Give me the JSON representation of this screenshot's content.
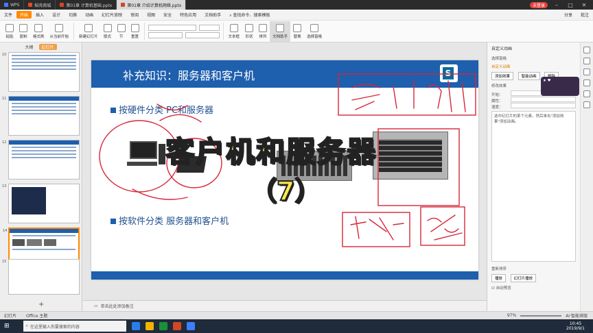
{
  "titlebar": {
    "tabs": [
      {
        "label": "WPS",
        "color": "#3d7eff"
      },
      {
        "label": "稻壳商城",
        "color": "#e34a2b"
      },
      {
        "label": "第01章 计算机基础.pptx",
        "color": "#d24726"
      },
      {
        "label": "第01章 介绍计算机网络.pptx",
        "color": "#d24726"
      }
    ],
    "login_badge": "未登录"
  },
  "menubar": {
    "file_label": "文件",
    "items": [
      "开始",
      "插入",
      "设计",
      "切换",
      "动画",
      "幻灯片放映",
      "审阅",
      "视图",
      "安全",
      "特色应用",
      "文档助手"
    ],
    "search_placeholder": "查找命令、搜索模板",
    "share": "分享",
    "comment": "批注"
  },
  "ribbon": {
    "buttons": [
      "粘贴",
      "复制",
      "格式刷",
      "从当前开始",
      "新建幻灯片",
      "版式",
      "节",
      "重置",
      "文本框",
      "形状",
      "排列",
      "文档助手",
      "替换",
      "选择窗格"
    ]
  },
  "leftpanel": {
    "tab_outline": "大纲",
    "tab_slides": "幻灯片",
    "slide_numbers": [
      "10",
      "11",
      "12",
      "13",
      "14",
      "15"
    ]
  },
  "slide": {
    "title": "补充知识：服务器和客户机",
    "bullet1": "按硬件分类  PC和服务器",
    "bullet2": "按软件分类  服务器和客户机",
    "overlay_title": "客户机和服务器",
    "overlay_num": "（7）"
  },
  "notes": {
    "placeholder": "单击此处添加备注"
  },
  "rightpanel": {
    "title": "自定义动画",
    "select_pane": "选择窗格",
    "section": "自定义动画",
    "add_effect": "添加效果",
    "smart_anim": "智能动画",
    "delete": "删除",
    "modify": "修改效果",
    "start_label": "开始：",
    "property_label": "属性：",
    "speed_label": "速度：",
    "hint": "选中幻灯片的某个元素，然后单击\"添加效果\"添加动画。",
    "reorder": "重新排序",
    "play": "播放",
    "slideshow": "幻灯片播放",
    "autopreview": "自动预览"
  },
  "statusbar": {
    "slide_label": "幻灯片",
    "theme": "Office 主题",
    "zoom": "97%",
    "ai": "AI·智能排版"
  },
  "taskbar": {
    "search_placeholder": "在这里输入你要搜索的内容",
    "time": "10:45",
    "date": "2019/9/1"
  }
}
